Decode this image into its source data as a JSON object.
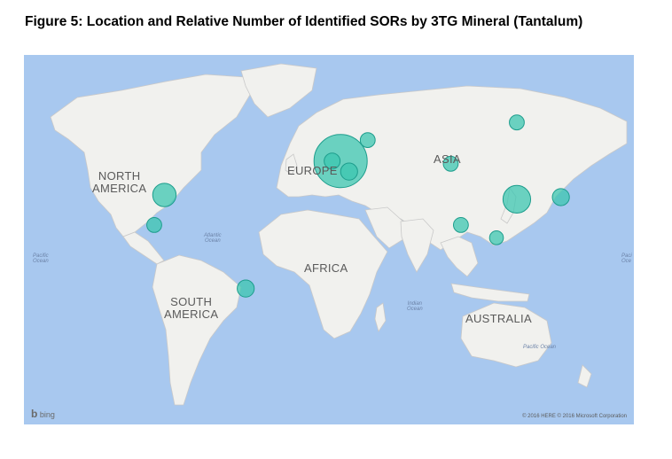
{
  "figure": {
    "title": "Figure 5: Location and Relative Number of Identified SORs by 3TG Mineral (Tantalum)"
  },
  "map": {
    "colors": {
      "ocean": "#a8c8ef",
      "land": "#f1f1ee",
      "border": "#c9c9c9",
      "bubble_fill": "#3cc5b0",
      "bubble_stroke": "#1d9d8c"
    },
    "continent_labels": {
      "north_america_1": "NORTH",
      "north_america_2": "AMERICA",
      "south_america_1": "SOUTH",
      "south_america_2": "AMERICA",
      "europe": "EUROPE",
      "asia": "ASIA",
      "africa": "AFRICA",
      "australia": "AUSTRALIA"
    },
    "ocean_labels": {
      "pacific_west_1": "Pacific",
      "pacific_west_2": "Ocean",
      "atlantic_1": "Atlantic",
      "atlantic_2": "Ocean",
      "indian_1": "Indian",
      "indian_2": "Ocean",
      "pacific_south": "Pacific Ocean",
      "pacific_east_1": "Paci",
      "pacific_east_2": "Oce"
    },
    "attribution": {
      "bing_logo": "bing",
      "copyright": "© 2016 HERE   © 2016 Microsoft Corporation"
    }
  },
  "bubbles": [
    {
      "region": "United States",
      "lon": -95,
      "lat": 37,
      "relative_size": 2.2
    },
    {
      "region": "Mexico",
      "lon": -101,
      "lat": 22,
      "relative_size": 1.4
    },
    {
      "region": "Brazil",
      "lon": -47,
      "lat": -14,
      "relative_size": 1.6
    },
    {
      "region": "Germany",
      "lon": 9,
      "lat": 51,
      "relative_size": 5.0
    },
    {
      "region": "Belgium / Netherlands",
      "lon": 4,
      "lat": 51,
      "relative_size": 1.5
    },
    {
      "region": "Austria",
      "lon": 14,
      "lat": 47,
      "relative_size": 1.6
    },
    {
      "region": "Estonia",
      "lon": 25,
      "lat": 58,
      "relative_size": 1.4
    },
    {
      "region": "Kazakhstan",
      "lon": 74,
      "lat": 50,
      "relative_size": 1.4
    },
    {
      "region": "Russia",
      "lon": 113,
      "lat": 63,
      "relative_size": 1.4
    },
    {
      "region": "China",
      "lon": 113,
      "lat": 35,
      "relative_size": 2.6
    },
    {
      "region": "Japan",
      "lon": 139,
      "lat": 36,
      "relative_size": 1.6
    },
    {
      "region": "India",
      "lon": 80,
      "lat": 22,
      "relative_size": 1.4
    },
    {
      "region": "Thailand",
      "lon": 101,
      "lat": 15,
      "relative_size": 1.3
    }
  ]
}
